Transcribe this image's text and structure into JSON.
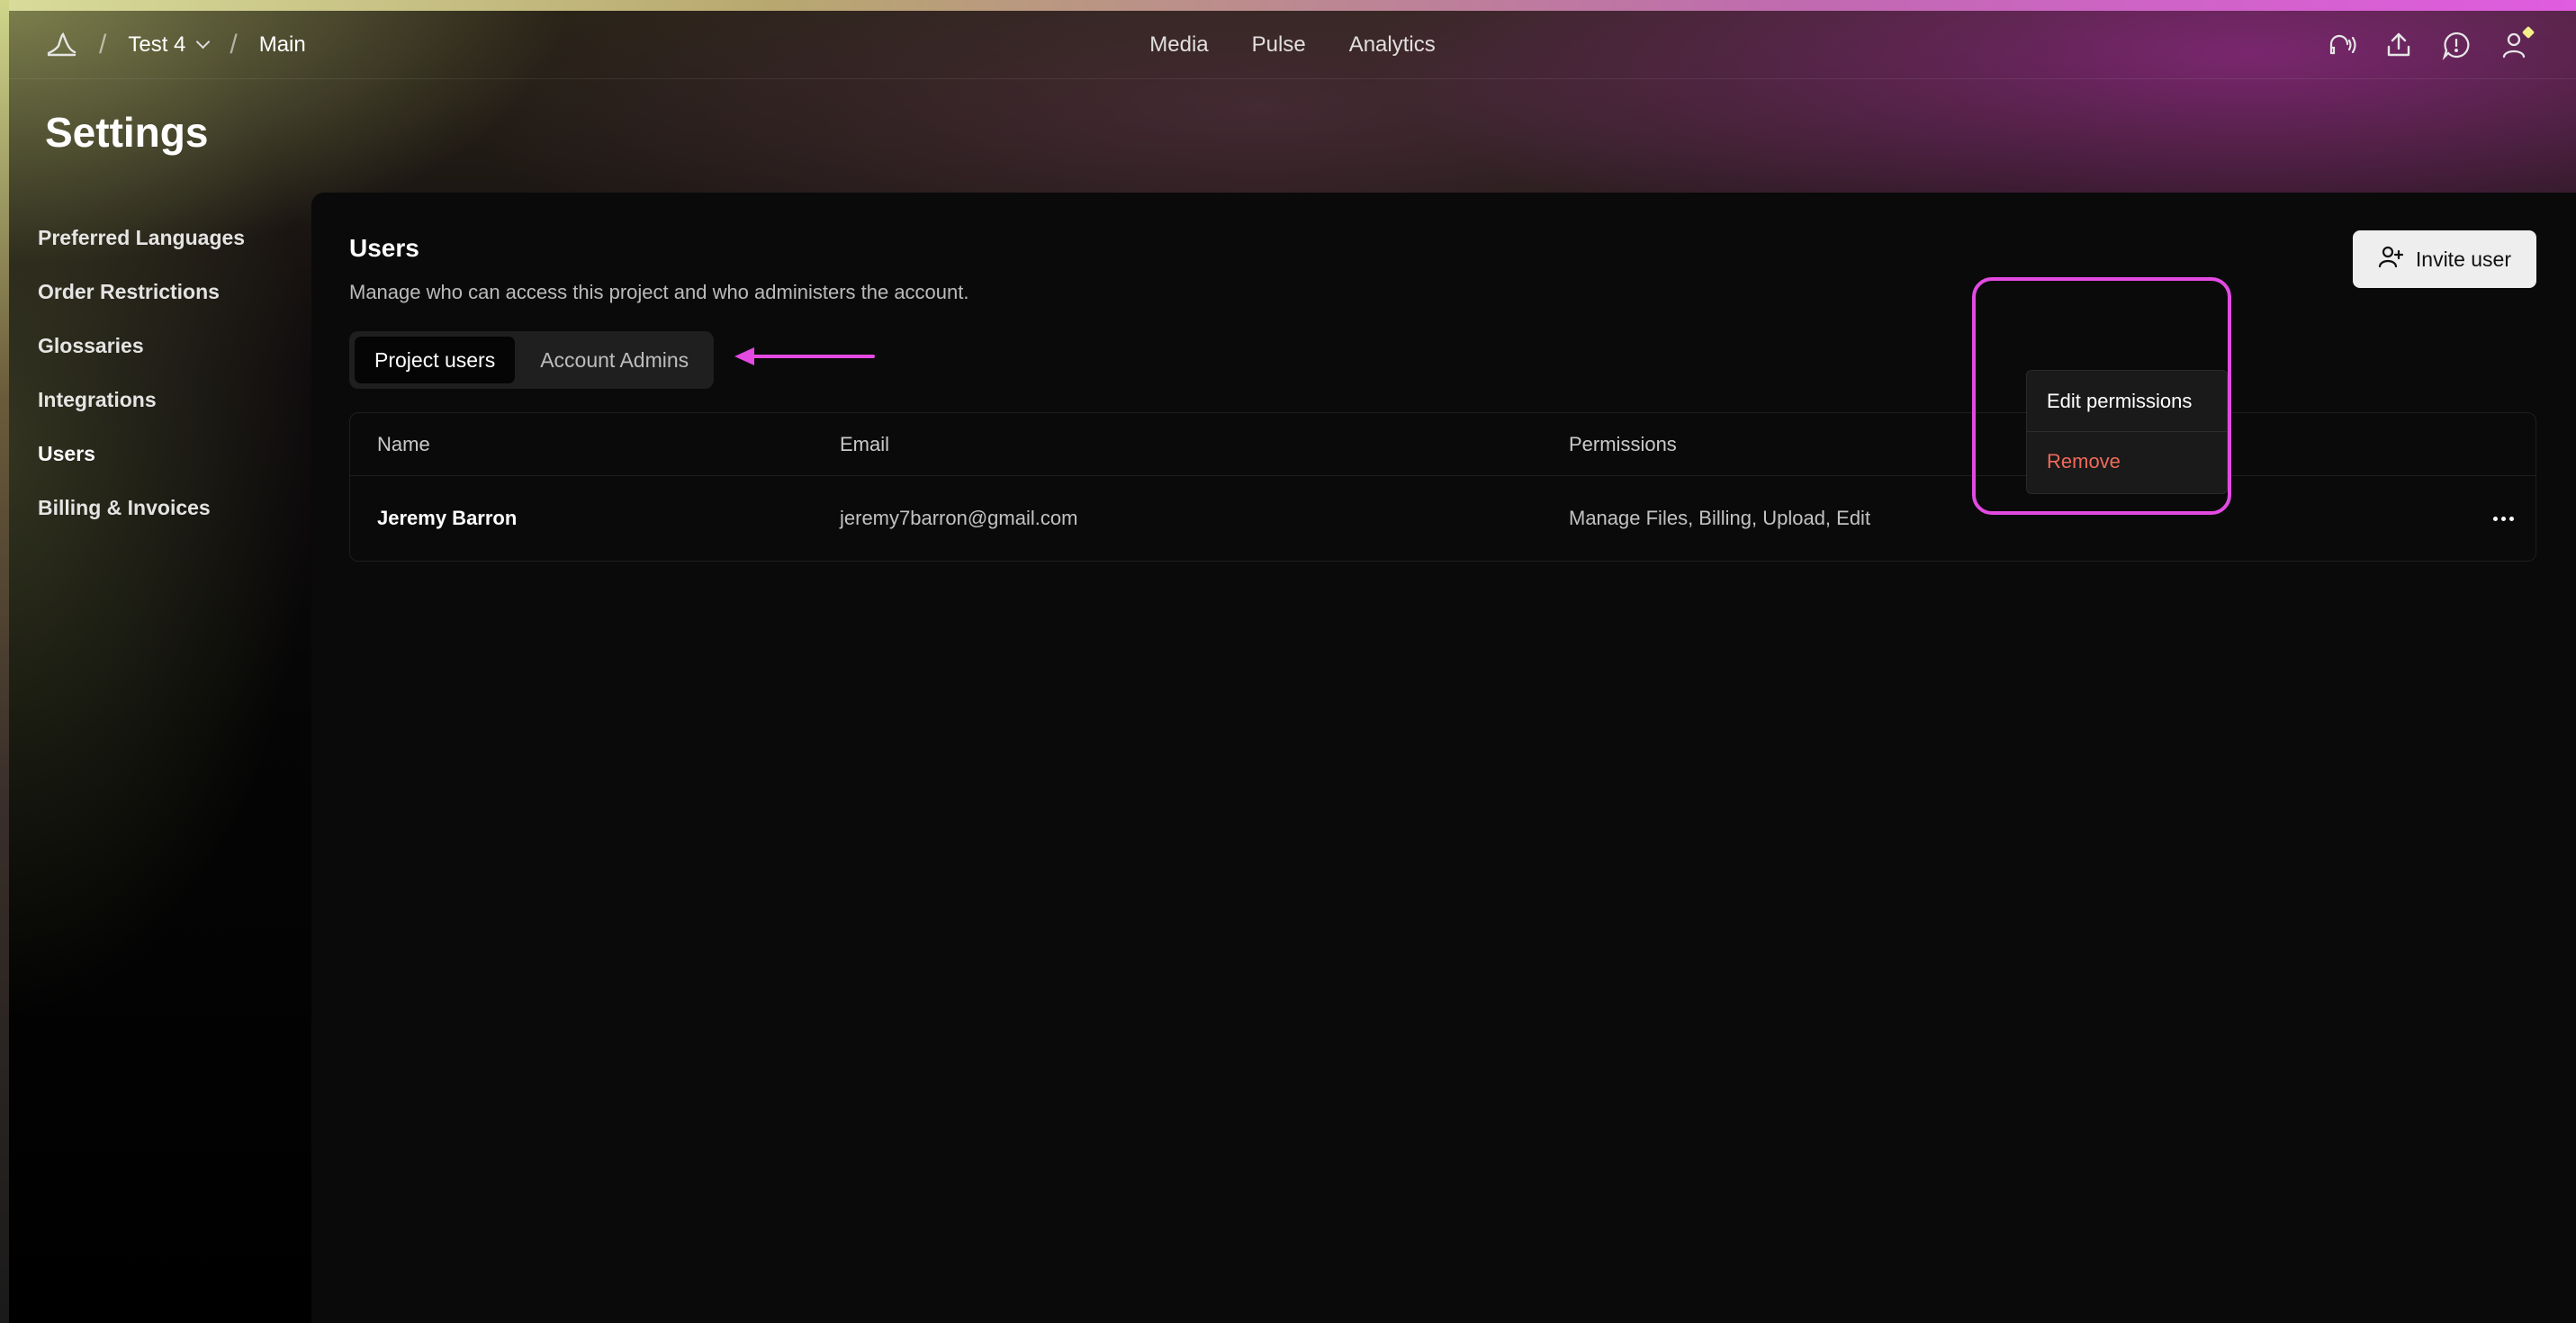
{
  "breadcrumb": {
    "project": "Test 4",
    "page": "Main"
  },
  "nav": {
    "media": "Media",
    "pulse": "Pulse",
    "analytics": "Analytics"
  },
  "header_icons": [
    "audio-icon",
    "upload-icon",
    "feedback-icon",
    "user-icon"
  ],
  "settings": {
    "title": "Settings"
  },
  "sidebar": {
    "items": [
      {
        "label": "Preferred Languages"
      },
      {
        "label": "Order Restrictions"
      },
      {
        "label": "Glossaries"
      },
      {
        "label": "Integrations"
      },
      {
        "label": "Users",
        "active": true
      },
      {
        "label": "Billing & Invoices"
      }
    ]
  },
  "users": {
    "title": "Users",
    "subtitle": "Manage who can access this project and who administers the account.",
    "invite_label": "Invite user",
    "tabs": [
      {
        "label": "Project users",
        "active": true
      },
      {
        "label": "Account Admins"
      }
    ],
    "columns": {
      "name": "Name",
      "email": "Email",
      "permissions": "Permissions"
    },
    "rows": [
      {
        "name": "Jeremy Barron",
        "email": "jeremy7barron@gmail.com",
        "permissions": "Manage Files, Billing, Upload, Edit"
      }
    ],
    "row_menu": {
      "edit": "Edit permissions",
      "remove": "Remove"
    }
  },
  "colors": {
    "accent": "#e24ae2",
    "danger": "#ef6a5a",
    "indicator": "#f3f08a"
  }
}
